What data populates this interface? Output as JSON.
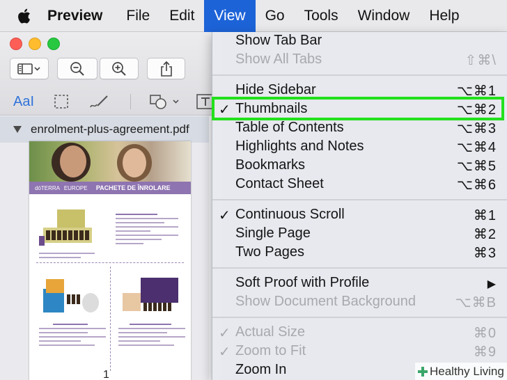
{
  "menubar": {
    "app_name": "Preview",
    "items": [
      "File",
      "Edit",
      "View",
      "Go",
      "Tools",
      "Window",
      "Help"
    ],
    "active_item": "View"
  },
  "toolbar": {
    "sidebar_icon": "sidebar-icon",
    "zoom_out_icon": "zoom-out-icon",
    "zoom_in_icon": "zoom-in-icon",
    "share_icon": "share-icon",
    "text_tool_label": "AaI"
  },
  "sidebar": {
    "filename": "enrolment-plus-agreement.pdf",
    "page_number": "1",
    "thumbnail": {
      "brand": "dōTERRA",
      "region": "EUROPE",
      "banner_title": "PACHETE DE ÎNROLARE"
    }
  },
  "view_menu": {
    "items": [
      {
        "check": "",
        "label": "Show Tab Bar",
        "shortcut": "",
        "disabled": false
      },
      {
        "check": "",
        "label": "Show All Tabs",
        "shortcut": "⇧⌘\\",
        "disabled": true
      },
      {
        "check": "",
        "label": "Hide Sidebar",
        "shortcut": "⌥⌘1",
        "disabled": false
      },
      {
        "check": "✓",
        "label": "Thumbnails",
        "shortcut": "⌥⌘2",
        "disabled": false
      },
      {
        "check": "",
        "label": "Table of Contents",
        "shortcut": "⌥⌘3",
        "disabled": false
      },
      {
        "check": "",
        "label": "Highlights and Notes",
        "shortcut": "⌥⌘4",
        "disabled": false
      },
      {
        "check": "",
        "label": "Bookmarks",
        "shortcut": "⌥⌘5",
        "disabled": false
      },
      {
        "check": "",
        "label": "Contact Sheet",
        "shortcut": "⌥⌘6",
        "disabled": false
      },
      {
        "check": "✓",
        "label": "Continuous Scroll",
        "shortcut": "⌘1",
        "disabled": false
      },
      {
        "check": "",
        "label": "Single Page",
        "shortcut": "⌘2",
        "disabled": false
      },
      {
        "check": "",
        "label": "Two Pages",
        "shortcut": "⌘3",
        "disabled": false
      },
      {
        "check": "",
        "label": "Soft Proof with Profile",
        "shortcut": "▶",
        "disabled": false
      },
      {
        "check": "",
        "label": "Show Document Background",
        "shortcut": "⌥⌘B",
        "disabled": true
      },
      {
        "check": "✓",
        "label": "Actual Size",
        "shortcut": "⌘0",
        "disabled": true
      },
      {
        "check": "✓",
        "label": "Zoom to Fit",
        "shortcut": "⌘9",
        "disabled": true
      },
      {
        "check": "",
        "label": "Zoom In",
        "shortcut": "",
        "disabled": false
      }
    ]
  },
  "highlight_color": "#22e01c",
  "menu_accent": "#1d63d8",
  "watermark": "Healthy Living"
}
